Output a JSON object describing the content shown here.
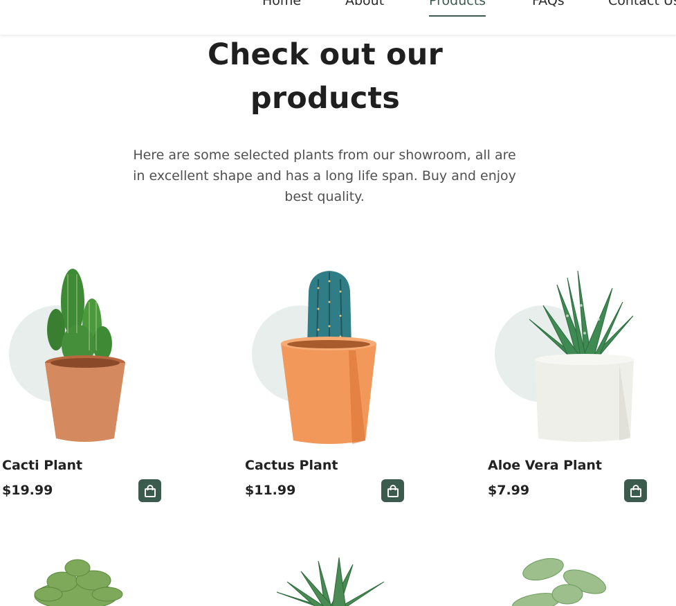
{
  "nav": {
    "items": [
      "Home",
      "About",
      "Products",
      "FAQs",
      "Contact Us"
    ],
    "active": "Products",
    "accent_color": "#3b5b4e"
  },
  "section": {
    "title_line1": "Check out our",
    "title_line2": "products",
    "subtitle": "Here are some selected plants from our showroom, all are in excellent shape and has a long life span. Buy and enjoy best quality."
  },
  "products": [
    {
      "name": "Cacti Plant",
      "price": "$19.99",
      "icon": "shopping-bag-icon"
    },
    {
      "name": "Cactus Plant",
      "price": "$11.99",
      "icon": "shopping-bag-icon"
    },
    {
      "name": "Aloe Vera Plant",
      "price": "$7.99",
      "icon": "shopping-bag-icon"
    }
  ]
}
